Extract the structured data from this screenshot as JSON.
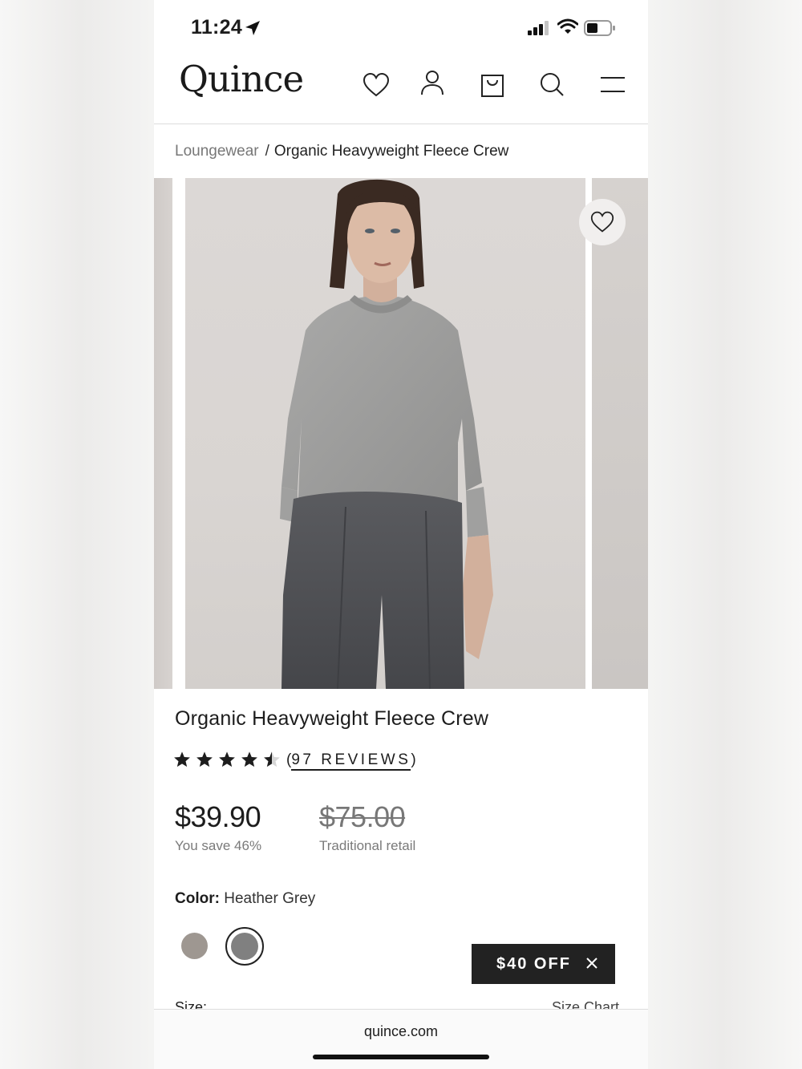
{
  "status_bar": {
    "time": "11:24"
  },
  "header": {
    "logo": "Quince",
    "icons": [
      "heart-icon",
      "account-icon",
      "bag-icon",
      "search-icon",
      "menu-icon"
    ]
  },
  "breadcrumb": {
    "parent": "Loungewear",
    "separator": "/",
    "current": "Organic Heavyweight Fleece Crew"
  },
  "product": {
    "title": "Organic Heavyweight Fleece Crew",
    "rating": 4.5,
    "reviews_label": "97 REVIEWS",
    "price": "$39.90",
    "savings": "You save 46%",
    "retail_price": "$75.00",
    "retail_label": "Traditional retail",
    "color_label": "Color:",
    "color_value": "Heather Grey",
    "swatches": [
      {
        "name": "Taupe",
        "color": "#9e9791",
        "selected": false
      },
      {
        "name": "Heather Grey",
        "color": "#808080",
        "selected": true
      }
    ],
    "size_label": "Size:",
    "size_chart": "Size Chart"
  },
  "promo": {
    "label": "$40 OFF"
  },
  "browser": {
    "url": "quince.com"
  },
  "colors": {
    "text": "#1d1d1d",
    "muted": "#7a7a7a",
    "promo_bg": "#222222"
  }
}
